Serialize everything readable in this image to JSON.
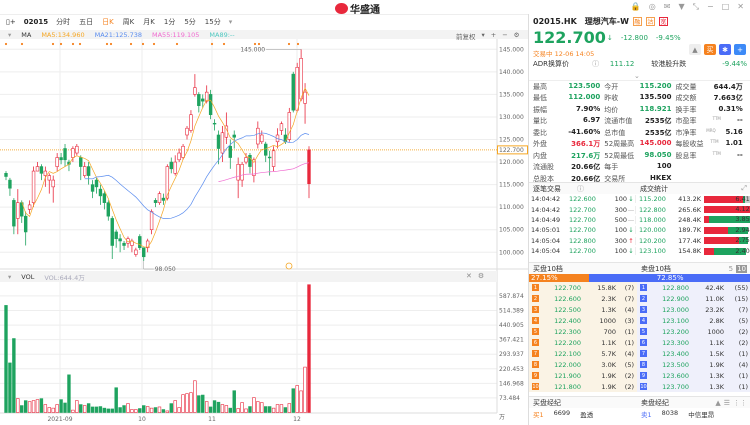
{
  "app": {
    "logo_text": "华盛通"
  },
  "toolbar": {
    "code": "02015",
    "tabs": [
      "分时",
      "五日",
      "日K",
      "周K",
      "月K",
      "1分",
      "5分",
      "15分"
    ],
    "active_tab": "日K"
  },
  "ma": {
    "label": "MA",
    "ma5": "MA5:134.960",
    "ma21": "MA21:125.738",
    "ma55": "MA55:119.105",
    "ma89": "MA89:--",
    "colors": {
      "ma5": "#f5a623",
      "ma21": "#5b8def",
      "ma55": "#f06ad0",
      "ma89": "#4fc8c0"
    }
  },
  "chart_ctl": {
    "adjust": "前复权",
    "plus": "+",
    "minus": "−"
  },
  "price_axis": {
    "ticks": [
      "145.000",
      "140.000",
      "135.000",
      "130.000",
      "125.000",
      "120.000",
      "115.000",
      "110.000",
      "105.000",
      "100.000"
    ],
    "current": "122.700",
    "high_label": "145.000",
    "low_label": "98.050"
  },
  "vol": {
    "label": "VOL",
    "value": "VOL:644.4万",
    "ticks": [
      "587.874",
      "514.389",
      "440.905",
      "367.421",
      "293.937",
      "220.453",
      "146.968",
      "73.484"
    ],
    "unit": "万"
  },
  "x_axis": [
    "2021-09",
    "10",
    "11",
    "12"
  ],
  "kline": [
    [
      117.5,
      116.8,
      118,
      116
    ],
    [
      116,
      114.2,
      116.5,
      112.5
    ],
    [
      111.5,
      105.8,
      112,
      104
    ],
    [
      107.5,
      111,
      114,
      104
    ],
    [
      111,
      108,
      111.5,
      106.5
    ],
    [
      108,
      104.5,
      109,
      101.5
    ],
    [
      109.5,
      110.5,
      111.5,
      108.5
    ],
    [
      111,
      118,
      119,
      110
    ],
    [
      118,
      119,
      120,
      118
    ],
    [
      119,
      117.5,
      119.5,
      116
    ],
    [
      117,
      118,
      119,
      114.5
    ],
    [
      116,
      117,
      117.5,
      113
    ],
    [
      114.5,
      116,
      117,
      111
    ],
    [
      119,
      121,
      122,
      118
    ],
    [
      121,
      120.5,
      122,
      119.5
    ],
    [
      123,
      120.5,
      124,
      119
    ],
    [
      120,
      119.5,
      120.5,
      118
    ],
    [
      121,
      123,
      123.5,
      120
    ],
    [
      122,
      123.5,
      124,
      121.5
    ],
    [
      121,
      119,
      121.5,
      116
    ],
    [
      117,
      119,
      120,
      116.5
    ],
    [
      119,
      117,
      120,
      115
    ],
    [
      115,
      113.5,
      116,
      112
    ],
    [
      116,
      114.5,
      116.5,
      113
    ],
    [
      114,
      112.5,
      115,
      110.5
    ],
    [
      113,
      111,
      113.5,
      109.5
    ],
    [
      111,
      108,
      111.5,
      107
    ],
    [
      107.5,
      101.5,
      108,
      98.5
    ],
    [
      104.5,
      103,
      105,
      101
    ],
    [
      103,
      102.5,
      104,
      100
    ],
    [
      102,
      101.5,
      102.5,
      100.5
    ],
    [
      102,
      103,
      103.5,
      101
    ],
    [
      101.5,
      102.5,
      103,
      100
    ],
    [
      99.5,
      100.5,
      101,
      99
    ],
    [
      103.5,
      101,
      104,
      100.5
    ],
    [
      101,
      99,
      101,
      98.05
    ],
    [
      101,
      102.5,
      103,
      100
    ],
    [
      105,
      109,
      109.5,
      104
    ],
    [
      111.5,
      111,
      112,
      110
    ],
    [
      111,
      113,
      113.5,
      110.5
    ],
    [
      112,
      111.5,
      113,
      110.5
    ],
    [
      112,
      119,
      119.5,
      111.5
    ],
    [
      120,
      118.5,
      121,
      117.5
    ],
    [
      117.5,
      120,
      121.5,
      117
    ],
    [
      120.5,
      122,
      123,
      120
    ],
    [
      121,
      123.5,
      124,
      120.5
    ],
    [
      126,
      127.5,
      128,
      125
    ],
    [
      127,
      130.5,
      131.5,
      126.5
    ],
    [
      135,
      136.5,
      139.5,
      134.5
    ],
    [
      135,
      132.5,
      135.5,
      131
    ],
    [
      134,
      133.5,
      135,
      132
    ],
    [
      133.5,
      135.5,
      137,
      133
    ],
    [
      135,
      130.5,
      136,
      129.5
    ],
    [
      128.6,
      128.5,
      129.5,
      127
    ],
    [
      126,
      123,
      127,
      119.5
    ],
    [
      122,
      126.5,
      128,
      120
    ],
    [
      125.5,
      128,
      131,
      124
    ],
    [
      123.5,
      121,
      125,
      118.5
    ],
    [
      126,
      125.5,
      127,
      123
    ],
    [
      116,
      119.5,
      121,
      112
    ],
    [
      116,
      119.5,
      120,
      114.5
    ],
    [
      120,
      121,
      122,
      119.5
    ],
    [
      121.5,
      119,
      122,
      117.5
    ],
    [
      117,
      120.5,
      121,
      115.5
    ],
    [
      124,
      127.5,
      129,
      123
    ],
    [
      124.5,
      126,
      127,
      124
    ],
    [
      124,
      121.5,
      124.5,
      120
    ],
    [
      121.1,
      121,
      122.5,
      117
    ],
    [
      119,
      122.5,
      123.5,
      118
    ],
    [
      124.5,
      126,
      127.5,
      123
    ],
    [
      127,
      128.5,
      129,
      126
    ],
    [
      126,
      124.5,
      127.5,
      124
    ],
    [
      125,
      131,
      132,
      124.5
    ],
    [
      139.5,
      131.5,
      140,
      131
    ],
    [
      131.5,
      141,
      142,
      131
    ],
    [
      134,
      143,
      145,
      133.5
    ],
    [
      133,
      135.5,
      137.5,
      128.5
    ],
    [
      115.2,
      122.7,
      123.5,
      112
    ]
  ],
  "volume": [
    540,
    250,
    373,
    70,
    35,
    60,
    55,
    60,
    65,
    70,
    40,
    25,
    22,
    40,
    65,
    48,
    190,
    12,
    60,
    40,
    35,
    45,
    28,
    28,
    30,
    22,
    18,
    18,
    125,
    25,
    35,
    45,
    15,
    15,
    20,
    35,
    30,
    22,
    25,
    28,
    15,
    8,
    45,
    60,
    25,
    90,
    95,
    100,
    160,
    85,
    88,
    55,
    28,
    60,
    52,
    40,
    35,
    22,
    110,
    20,
    50,
    18,
    30,
    75,
    55,
    50,
    30,
    30,
    22,
    40,
    40,
    25,
    45,
    120,
    136,
    109,
    229,
    644.4
  ],
  "colors": {
    "up": "#e8283c",
    "down": "#1ea35f",
    "accent": "#f5821f",
    "ask": "#4a6cf7"
  },
  "quote": {
    "code": "02015.HK",
    "name": "理想汽车-W",
    "badges": [
      "融",
      "沽",
      "宽"
    ],
    "price": "122.700",
    "arrow": "↓",
    "change": "-12.800",
    "change_pct": "-9.45%",
    "status": "交易中 12-06 14:05",
    "adr_label": "ADR换算价",
    "adr_value": "111.12",
    "adr_chg_label": "较港股升跌",
    "adr_chg": "-9.44%",
    "chevron": "⌄"
  },
  "stats": [
    [
      [
        "最高",
        "123.500",
        "g",
        ""
      ],
      [
        "今开",
        "115.200",
        "g",
        ""
      ],
      [
        "成交量",
        "644.4万",
        "",
        ""
      ]
    ],
    [
      [
        "最低",
        "112.000",
        "g",
        ""
      ],
      [
        "昨收",
        "135.500",
        "",
        ""
      ],
      [
        "成交额",
        "7.663亿",
        "",
        ""
      ]
    ],
    [
      [
        "振幅",
        "7.90%",
        "",
        ""
      ],
      [
        "均价",
        "118.921",
        "g",
        ""
      ],
      [
        "换手率",
        "0.31%",
        "",
        ""
      ]
    ],
    [
      [
        "量比",
        "6.97",
        "",
        ""
      ],
      [
        "流通市值",
        "2535亿",
        "",
        ""
      ],
      [
        "市盈率",
        "--",
        "",
        "TTM"
      ]
    ],
    [
      [
        "委比",
        "-41.60%",
        "",
        ""
      ],
      [
        "总市值",
        "2535亿",
        "",
        ""
      ],
      [
        "市净率",
        "5.16",
        "",
        "MRQ"
      ]
    ],
    [
      [
        "外盘",
        "366.1万",
        "r",
        ""
      ],
      [
        "52周最高",
        "145.000",
        "r",
        ""
      ],
      [
        "每股收益",
        "1.01",
        "",
        "TTM"
      ]
    ],
    [
      [
        "内盘",
        "217.6万",
        "g",
        ""
      ],
      [
        "52周最低",
        "98.050",
        "g",
        ""
      ],
      [
        "股息率",
        "--",
        "",
        "TTM"
      ]
    ],
    [
      [
        "流通股",
        "20.66亿",
        "",
        ""
      ],
      [
        "每手",
        "100",
        "",
        ""
      ],
      [
        "",
        "",
        "",
        ""
      ]
    ],
    [
      [
        "总股本",
        "20.66亿",
        "",
        ""
      ],
      [
        "交易所",
        "HKEX",
        "",
        ""
      ],
      [
        "",
        "",
        "",
        ""
      ]
    ]
  ],
  "trades": {
    "title": "逐笔交易",
    "stats_title": "成交统计",
    "rows": [
      [
        "14:04:42",
        "122.600",
        "100",
        "down"
      ],
      [
        "14:04:42",
        "122.700",
        "300",
        "flat"
      ],
      [
        "14:04:49",
        "122.700",
        "500",
        "flat"
      ],
      [
        "14:05:01",
        "122.700",
        "100",
        "down"
      ],
      [
        "14:05:04",
        "122.800",
        "300",
        "up"
      ],
      [
        "14:05:04",
        "122.700",
        "100",
        "down"
      ]
    ],
    "stat_rows": [
      [
        "115.200",
        "413.2K",
        "6.41%",
        1.0,
        0.75,
        0.03
      ],
      [
        "122.800",
        "265.6K",
        "4.12%",
        1.0,
        0.95,
        0.0
      ],
      [
        "118.000",
        "248.4K",
        "3.85%",
        1.0,
        0.1,
        0.9
      ],
      [
        "120.000",
        "189.7K",
        "2.94%",
        0.85,
        0.55,
        0.45
      ],
      [
        "120.200",
        "177.4K",
        "2.75%",
        0.85,
        0.8,
        0.2
      ],
      [
        "123.100",
        "154.8K",
        "2.40%",
        0.8,
        0.25,
        0.75
      ]
    ]
  },
  "book": {
    "bid_title": "买盘10档",
    "ask_title": "卖盘10档",
    "depth_5": "5",
    "depth_10": "10",
    "bid_pct": "27.15%",
    "ask_pct": "72.85%",
    "bid_frac": 27.15,
    "bids": [
      [
        "122.700",
        "15.8K",
        "(7)"
      ],
      [
        "122.600",
        "2.3K",
        "(7)"
      ],
      [
        "122.500",
        "1.3K",
        "(4)"
      ],
      [
        "122.400",
        "1000",
        "(3)"
      ],
      [
        "122.300",
        "700",
        "(1)"
      ],
      [
        "122.200",
        "1.1K",
        "(1)"
      ],
      [
        "122.100",
        "5.7K",
        "(4)"
      ],
      [
        "122.000",
        "3.0K",
        "(5)"
      ],
      [
        "121.900",
        "1.9K",
        "(2)"
      ],
      [
        "121.800",
        "1.9K",
        "(2)"
      ]
    ],
    "asks": [
      [
        "122.800",
        "42.4K",
        "(55)"
      ],
      [
        "122.900",
        "11.0K",
        "(15)"
      ],
      [
        "123.000",
        "23.2K",
        "(7)"
      ],
      [
        "123.100",
        "2.8K",
        "(5)"
      ],
      [
        "123.200",
        "1000",
        "(2)"
      ],
      [
        "123.300",
        "1.1K",
        "(2)"
      ],
      [
        "123.400",
        "1.5K",
        "(1)"
      ],
      [
        "123.500",
        "1.9K",
        "(4)"
      ],
      [
        "123.600",
        "1.3K",
        "(1)"
      ],
      [
        "123.700",
        "1.3K",
        "(1)"
      ]
    ]
  },
  "broker": {
    "buy_title": "买盘经纪",
    "sell_title": "卖盘经纪",
    "buy": [
      "买1",
      "6699",
      "盈透"
    ],
    "sell": [
      "卖1",
      "8038",
      "中信里昂"
    ]
  }
}
